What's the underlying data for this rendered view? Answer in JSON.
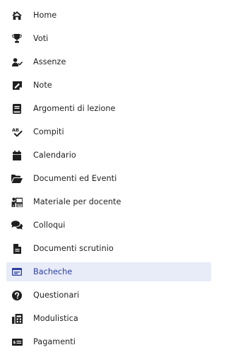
{
  "menu": {
    "active_index": 12,
    "accent_color": "#2c3f9c",
    "active_background": "#e8ebf8",
    "items": [
      {
        "label": "Home",
        "icon": "home-icon"
      },
      {
        "label": "Voti",
        "icon": "trophy-icon"
      },
      {
        "label": "Assenze",
        "icon": "user-check-icon"
      },
      {
        "label": "Note",
        "icon": "note-icon"
      },
      {
        "label": "Argomenti di lezione",
        "icon": "book-icon"
      },
      {
        "label": "Compiti",
        "icon": "spell-check-icon"
      },
      {
        "label": "Calendario",
        "icon": "calendar-icon"
      },
      {
        "label": "Documenti ed Eventi",
        "icon": "folder-open-icon"
      },
      {
        "label": "Materiale per docente",
        "icon": "teacher-material-icon"
      },
      {
        "label": "Colloqui",
        "icon": "comments-icon"
      },
      {
        "label": "Documenti scrutinio",
        "icon": "file-icon"
      },
      {
        "label": "Bacheche",
        "icon": "board-icon"
      },
      {
        "label": "Questionari",
        "icon": "question-circle-icon"
      },
      {
        "label": "Modulistica",
        "icon": "forms-icon"
      },
      {
        "label": "Pagamenti",
        "icon": "money-bill-icon"
      }
    ]
  }
}
